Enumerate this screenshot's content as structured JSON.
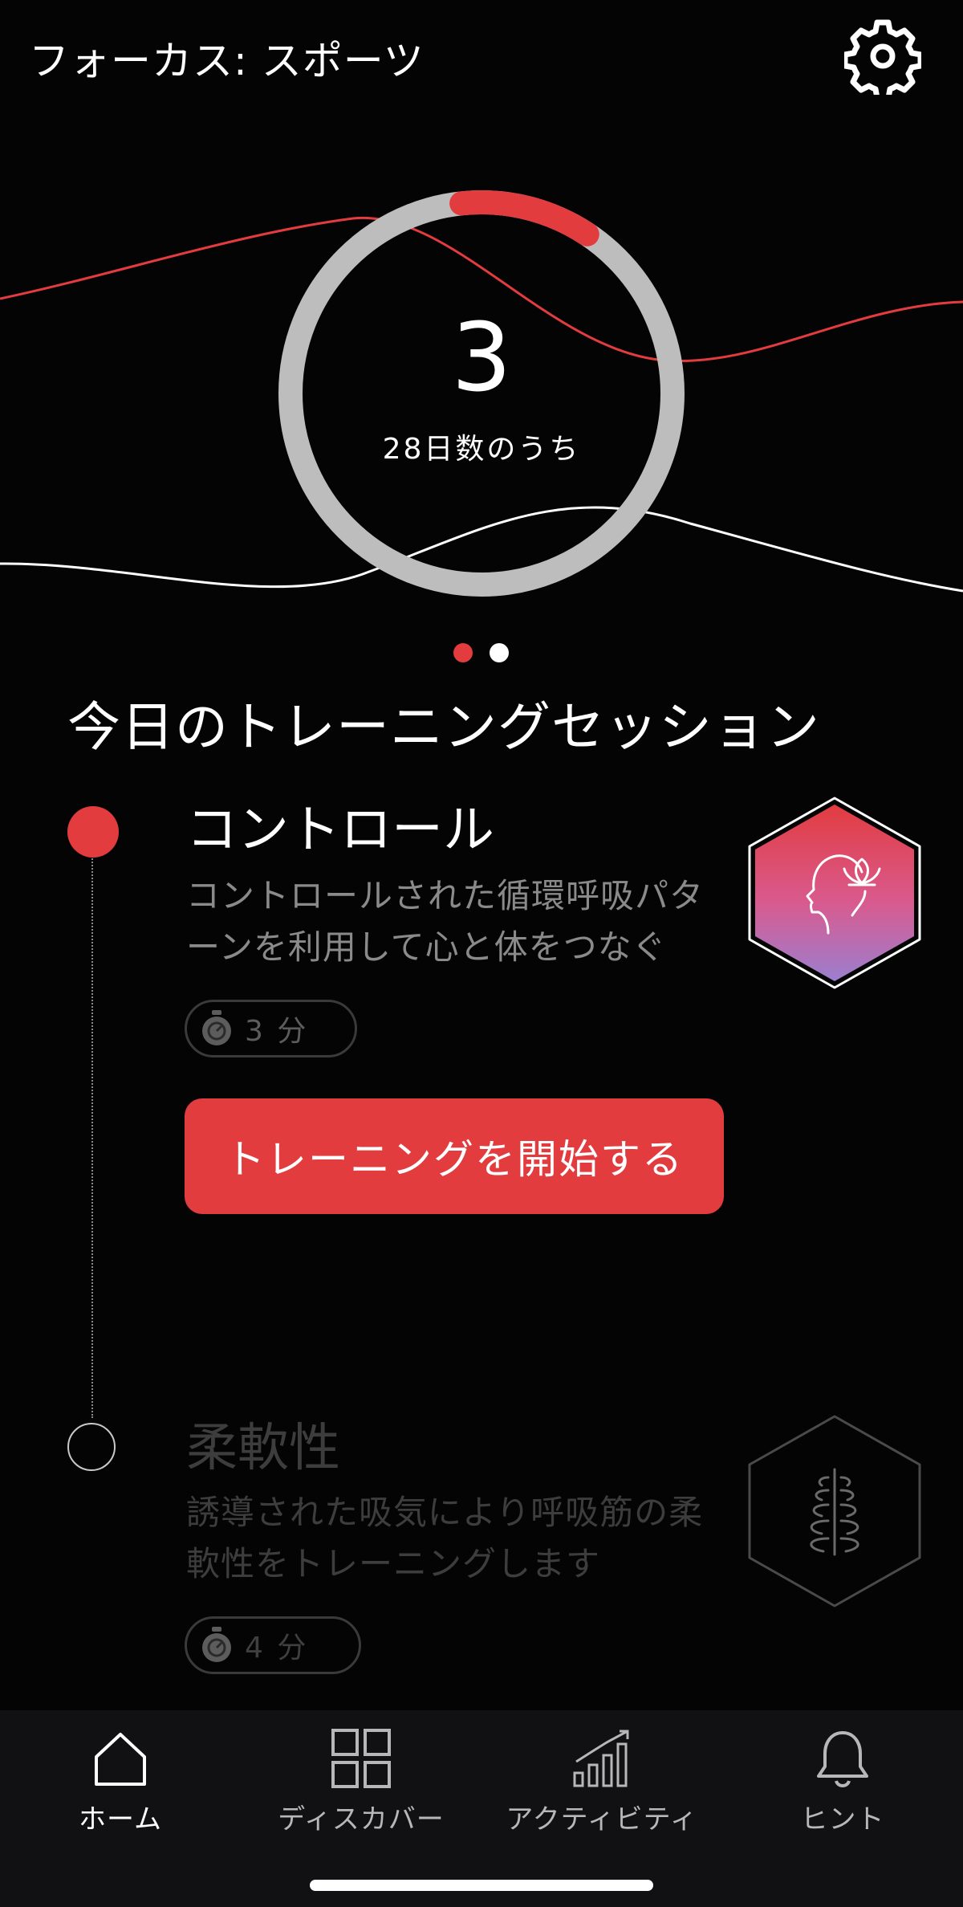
{
  "header": {
    "title": "フォーカス: スポーツ",
    "settings_icon": "gear-icon"
  },
  "progress": {
    "current_day": "3",
    "caption": "28日数のうち",
    "fraction_complete": 0.11,
    "ring_color": "#bdbdbd",
    "accent_color": "#e23c3f"
  },
  "pager": {
    "pages": 2,
    "active_index": 0
  },
  "section": {
    "title": "今日のトレーニングセッション"
  },
  "sessions": [
    {
      "name": "コントロール",
      "description_line1": "コントロールされた循環呼吸パタ",
      "description_line2": "ーンを利用して心と体をつなぐ",
      "duration": "3 分",
      "icon": "head-lotus-icon",
      "state": "active"
    },
    {
      "name": "柔軟性",
      "description_line1": "誘導された吸気により呼吸筋の柔",
      "description_line2": "軟性をトレーニングします",
      "duration": "4 分",
      "icon": "ribcage-icon",
      "state": "locked"
    }
  ],
  "start_button": {
    "label": "トレーニングを開始する"
  },
  "tabbar": {
    "tabs": [
      {
        "label": "ホーム",
        "icon": "home-icon",
        "active": true
      },
      {
        "label": "ディスカバー",
        "icon": "grid-icon",
        "active": false
      },
      {
        "label": "アクティビティ",
        "icon": "bar-chart-icon",
        "active": false
      },
      {
        "label": "ヒント",
        "icon": "bell-icon",
        "active": false
      }
    ]
  }
}
